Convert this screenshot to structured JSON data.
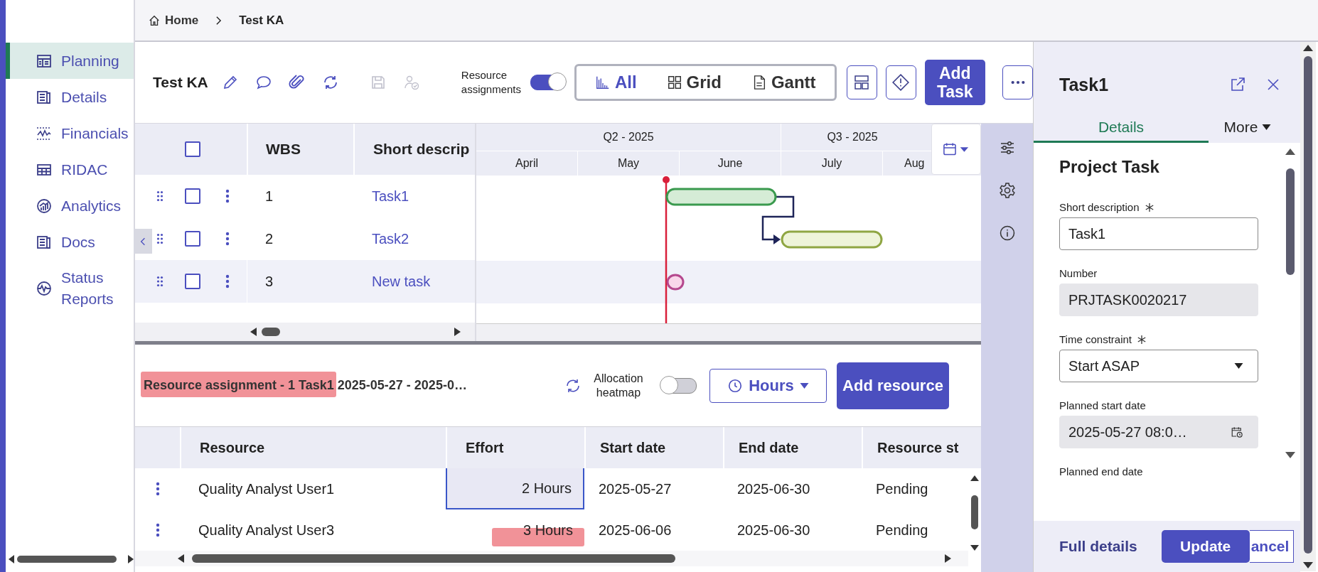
{
  "breadcrumb": {
    "home": "Home",
    "current": "Test KA"
  },
  "sidebar": {
    "items": [
      {
        "label": "Planning",
        "kind": "planning",
        "selected": true
      },
      {
        "label": "Details",
        "kind": "details",
        "selected": false
      },
      {
        "label": "Financials",
        "kind": "financials",
        "selected": false
      },
      {
        "label": "RIDAC",
        "kind": "table",
        "selected": false
      },
      {
        "label": "Analytics",
        "kind": "analytics",
        "selected": false
      },
      {
        "label": "Docs",
        "kind": "details",
        "selected": false
      },
      {
        "label": "Status Reports",
        "kind": "status",
        "selected": false
      }
    ]
  },
  "toolbar": {
    "title": "Test KA",
    "actions": [
      {
        "kind": "edit",
        "disabled": false
      },
      {
        "kind": "comment",
        "disabled": false
      },
      {
        "kind": "attach",
        "disabled": false
      },
      {
        "kind": "refresh",
        "disabled": false
      },
      {
        "kind": "save",
        "disabled": true
      },
      {
        "kind": "assign",
        "disabled": true
      }
    ],
    "resource_toggle": {
      "label": "Resource assignments",
      "on": true
    },
    "views": [
      {
        "label": "All",
        "kind": "chart",
        "selected": true
      },
      {
        "label": "Grid",
        "kind": "grid",
        "selected": false
      },
      {
        "label": "Gantt",
        "kind": "doc",
        "selected": false
      }
    ],
    "add_button": "Add Task"
  },
  "grid": {
    "all_checked": false,
    "columns": [
      "WBS",
      "Short descrip"
    ],
    "rows": [
      {
        "wbs": "1",
        "description": "Task1",
        "checked": false,
        "color": "#3a9a4e"
      },
      {
        "wbs": "2",
        "description": "Task2",
        "checked": false,
        "color": "#8fa643"
      },
      {
        "wbs": "3",
        "description": "New task",
        "checked": false,
        "color": "#b5488e"
      }
    ]
  },
  "gantt": {
    "quarters": [
      "Q2 - 2025",
      "Q3 - 2025"
    ],
    "months": [
      "April",
      "May",
      "June",
      "July",
      "Aug"
    ]
  },
  "resources": {
    "title": "Resource assignment - 1 Task1 2025-05-27 - 2025-0…",
    "title_marked": true,
    "heatmap": {
      "label": "Allocation heatmap",
      "on": false
    },
    "unit": "Hours",
    "add_button": "Add resource",
    "columns": [
      "Resource",
      "Effort",
      "Start date",
      "End date",
      "Resource st"
    ],
    "rows": [
      {
        "resource": "Quality Analyst User1",
        "effort": "2 Hours",
        "start": "2025-05-27",
        "end": "2025-06-30",
        "status": "Pending",
        "selected": true,
        "marked": false
      },
      {
        "resource": "Quality Analyst User3",
        "effort": "3 Hours",
        "start": "2025-06-06",
        "end": "2025-06-30",
        "status": "Pending",
        "selected": false,
        "marked": true
      }
    ]
  },
  "panel": {
    "title": "Task1",
    "tabs": [
      {
        "label": "Details",
        "selected": true
      },
      {
        "label": "More",
        "selected": false
      }
    ],
    "heading": "Project Task",
    "fields": [
      {
        "label": "Short description",
        "required": true,
        "kind": "text",
        "value": "Task1"
      },
      {
        "label": "Number",
        "required": false,
        "kind": "readonly",
        "value": "PRJTASK0020217"
      },
      {
        "label": "Time constraint",
        "required": true,
        "kind": "select",
        "value": "Start ASAP"
      },
      {
        "label": "Planned start date",
        "required": false,
        "kind": "date",
        "value": "2025-05-27 08:0…"
      },
      {
        "label": "Planned end date",
        "required": false,
        "kind": "label"
      }
    ],
    "footer": {
      "link": "Full details",
      "update": "Update",
      "cancel": "ancel"
    }
  }
}
